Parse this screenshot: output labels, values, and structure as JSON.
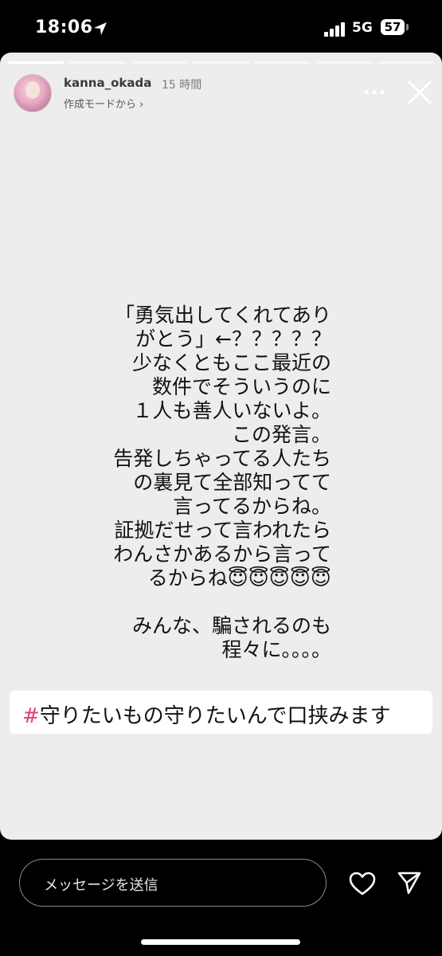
{
  "status_bar": {
    "time": "18:06",
    "network": "5G",
    "battery": "57"
  },
  "story": {
    "progress": [
      1,
      0,
      0,
      0,
      0,
      0,
      0
    ],
    "username": "kanna_okada",
    "time_ago": "15 時間",
    "source": "作成モードから ›",
    "text_lines": [
      "「勇気出してくれてあり",
      "がとう」←？？？？？",
      "少なくともここ最近の",
      "数件でそういうのに",
      "１人も善人いないよ。",
      "この発言。",
      "告発しちゃってる人たち",
      "の裏見て全部知ってて",
      "言ってるからね。",
      "証拠だせって言われたら",
      "わんさかあるから言って",
      "るからね😇😇😇😇😇",
      "",
      "みんな、騙されるのも",
      "程々に。。。。"
    ],
    "hashtag_mark": "#",
    "hashtag_text": "守りたいもの守りたいんで口挟みます"
  },
  "bottom_bar": {
    "message_placeholder": "メッセージを送信"
  }
}
